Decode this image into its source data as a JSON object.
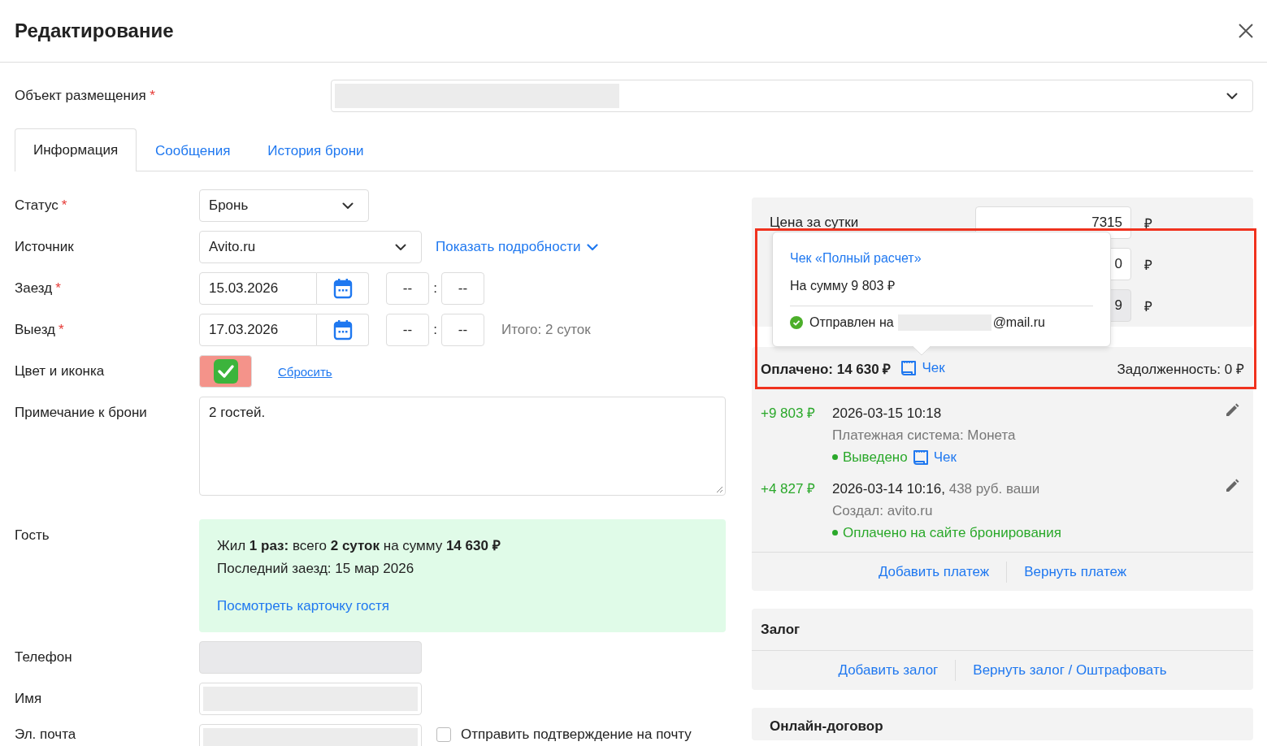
{
  "window": {
    "title": "Редактирование"
  },
  "object_field": {
    "label": "Объект размещения",
    "required_mark": "*"
  },
  "tabs": [
    {
      "label": "Информация",
      "selected": true
    },
    {
      "label": "Сообщения",
      "selected": false
    },
    {
      "label": "История брони",
      "selected": false
    }
  ],
  "form": {
    "status": {
      "label": "Статус",
      "required_mark": "*",
      "value": "Бронь"
    },
    "source": {
      "label": "Источник",
      "value": "Avito.ru",
      "details_link": "Показать подробности"
    },
    "checkin": {
      "label": "Заезд",
      "required_mark": "*",
      "date": "15.03.2026",
      "hour": "--",
      "time_separator": ":",
      "minute": "--"
    },
    "checkout": {
      "label": "Выезд",
      "required_mark": "*",
      "date": "17.03.2026",
      "hour": "--",
      "time_separator": ":",
      "minute": "--",
      "total": "Итого: 2 суток"
    },
    "color": {
      "label": "Цвет и иконка",
      "reset_link": "Сбросить"
    },
    "note": {
      "label": "Примечание к брони",
      "value": "2 гостей."
    },
    "guest": {
      "label": "Гость",
      "summary": "Жил **1 раз:** всего **2 суток** на сумму **14 630 ₽**",
      "last_visit": "Последний заезд: 15 мар 2026",
      "card_link": "Посмотреть карточку гостя"
    },
    "phone": {
      "label": "Телефон"
    },
    "name": {
      "label": "Имя"
    },
    "email": {
      "label": "Эл. почта",
      "send_confirmation": {
        "label": "Отправить подтверждение на почту",
        "checked": false
      }
    }
  },
  "pricing": {
    "rows": [
      {
        "label": "Цена за сутки",
        "value": "7315",
        "currency": "₽",
        "disabled": false
      },
      {
        "value": "0",
        "currency": "₽",
        "disabled": false
      },
      {
        "value": "9",
        "currency": "₽",
        "disabled": true
      }
    ]
  },
  "receipt_popover": {
    "title": "Чек «Полный расчет»",
    "amount": "На сумму 9 803 ₽",
    "sent_label": "Отправлен на",
    "email_suffix": "@mail.ru"
  },
  "payments": {
    "paid": "Оплачено: 14 630 ₽",
    "receipt_link": "Чек",
    "debt": "Задолженность: 0 ₽",
    "items": [
      {
        "amount": "+9 803 ₽",
        "datetime": "2026-03-15 10:18",
        "detail": "Платежная система: Монета",
        "status": "Выведено",
        "receipt_link": "Чек"
      },
      {
        "amount": "+4 827 ₽",
        "datetime": "2026-03-14 10:16,",
        "comment": "438 руб. ваши",
        "detail": "Создал: avito.ru",
        "status": "Оплачено на сайте бронирования"
      }
    ],
    "actions": [
      "Добавить платеж",
      "Вернуть платеж"
    ]
  },
  "deposit": {
    "title": "Залог",
    "actions": [
      "Добавить залог",
      "Вернуть залог / Оштрафовать"
    ]
  },
  "contract": {
    "title": "Онлайн-договор"
  }
}
